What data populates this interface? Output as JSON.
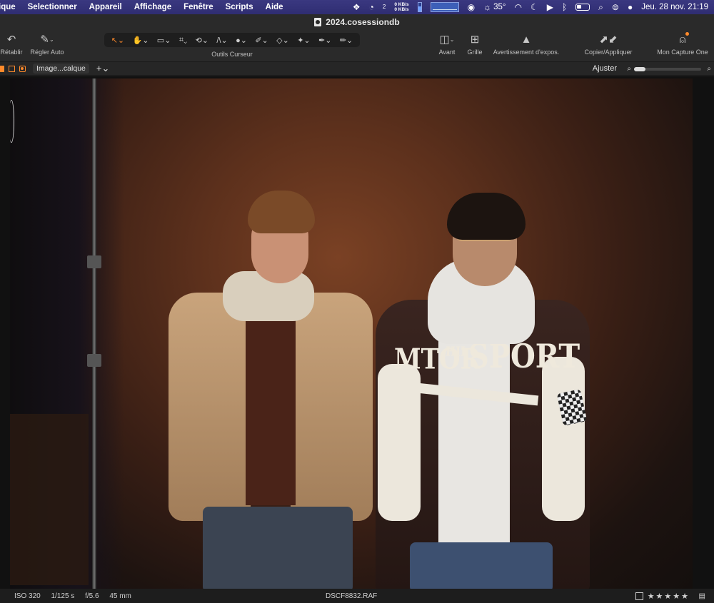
{
  "menubar": {
    "items": [
      "ique",
      "Selectionner",
      "Appareil",
      "Affichage",
      "Fenêtre",
      "Scripts",
      "Aide"
    ],
    "net_up": "0 KB/s",
    "net_down": "0 KB/s",
    "temperature": "35°",
    "datetime": "Jeu. 28 nov.  21:19",
    "counter_small": "2"
  },
  "window": {
    "title": "2024.cosessiondb"
  },
  "toolbar": {
    "retablir": "Rétablir",
    "regler_auto": "Régler Auto",
    "cursor_tools_label": "Outils Curseur",
    "avant": "Avant",
    "grille": "Grille",
    "avertissement": "Avertissement d'expos.",
    "copier": "Copier/Appliquer",
    "capture_one": "Mon Capture One"
  },
  "subbar": {
    "layer": "Image...calque",
    "fit": "Ajuster"
  },
  "photo": {
    "jacket_text_left": "MTOR",
    "jacket_text_chest": "HIL",
    "jacket_text_right": "SPORT"
  },
  "status": {
    "iso": "ISO 320",
    "shutter": "1/125 s",
    "aperture": "f/5.6",
    "focal": "45 mm",
    "filename": "DSCF8832.RAF",
    "stars": "★★★★★"
  },
  "colors": {
    "accent": "#ff8a2b",
    "menubar": "#2f2d72",
    "chrome": "#2a2a2a"
  }
}
